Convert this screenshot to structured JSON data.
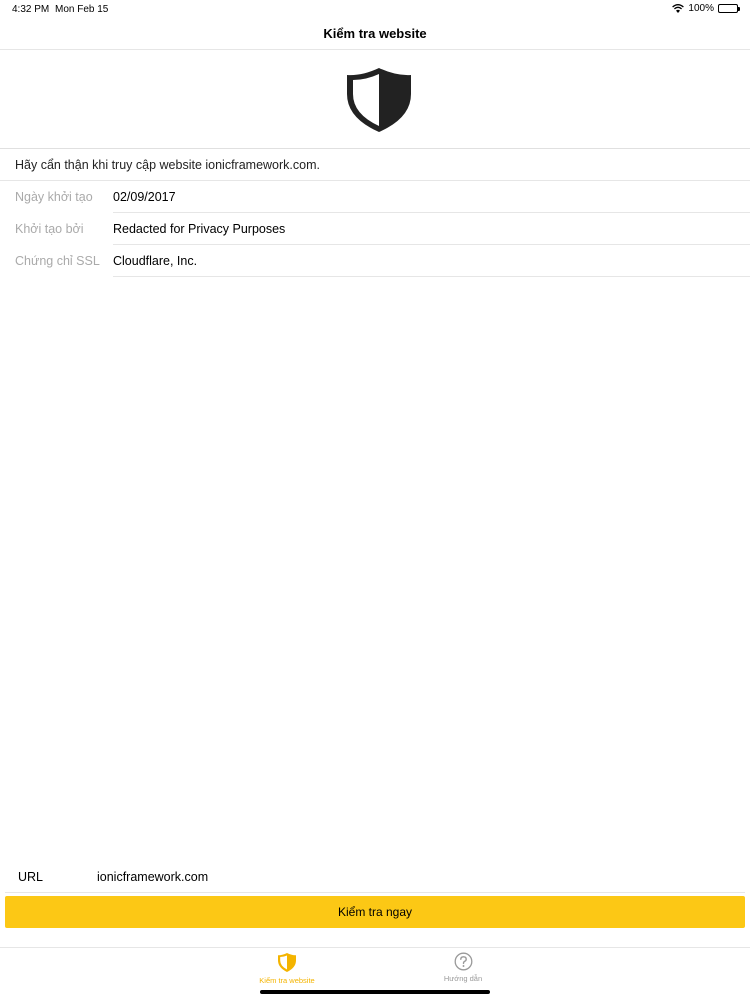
{
  "status": {
    "time": "4:32 PM",
    "date": "Mon Feb 15",
    "battery": "100%"
  },
  "nav": {
    "title": "Kiểm tra website"
  },
  "warning": "Hãy cẩn thận khi truy cập website ionicframework.com.",
  "info": [
    {
      "label": "Ngày khởi tạo",
      "value": "02/09/2017"
    },
    {
      "label": "Khởi tạo bởi",
      "value": "Redacted for Privacy Purposes"
    },
    {
      "label": "Chứng chỉ SSL",
      "value": "Cloudflare, Inc."
    }
  ],
  "url": {
    "label": "URL",
    "value": "ionicframework.com"
  },
  "check_button": "Kiểm tra ngay",
  "tabs": [
    {
      "label": "Kiểm tra website",
      "icon": "shield-icon"
    },
    {
      "label": "Hướng dẫn",
      "icon": "help-circle-icon"
    }
  ],
  "colors": {
    "accent": "#fcc815",
    "tab_active": "#f4b400",
    "label_gray": "#aaaaaa"
  }
}
